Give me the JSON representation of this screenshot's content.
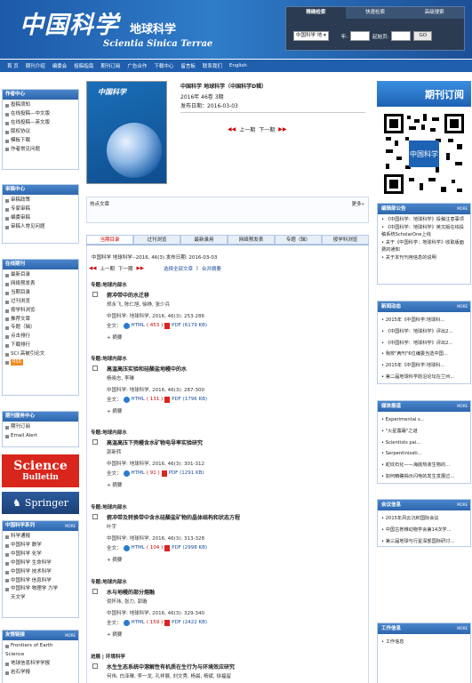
{
  "header": {
    "logo_cn": "中国科学",
    "logo_sub": "地球科学",
    "logo_en": "Scientia Sinica Terrae"
  },
  "search": {
    "tabs": [
      "精确检索",
      "快速检索",
      "高级搜索"
    ],
    "journal_select": "中国科学 地",
    "year_label": "年:",
    "page_label": "起始页:",
    "go": "GO"
  },
  "nav": [
    "首 页",
    "期刊介绍",
    "编委会",
    "投稿指南",
    "期刊订阅",
    "广告合作",
    "下载中心",
    "留言板",
    "联系我们",
    "English"
  ],
  "left": {
    "author_center": {
      "title": "作者中心",
      "items": [
        "投稿须知",
        "在线投稿—中文版",
        "在线投稿—英文版",
        "版权协议",
        "模板下载",
        "作者常见问题"
      ]
    },
    "review_center": {
      "title": "审稿中心",
      "items": [
        "审稿政策",
        "专家审稿",
        "编委审稿",
        "审稿人常见问题"
      ]
    },
    "online": {
      "title": "在线期刊",
      "items": [
        "最新目录",
        "网络预发表",
        "当期目录",
        "过刊浏览",
        "按学科浏览",
        "推荐文章",
        "专题（辑）",
        "点击排行",
        "下载排行",
        "SCI 高被引论文"
      ],
      "rss": "RSS"
    },
    "service": {
      "title": "期刊服务中心",
      "items": [
        "期刊订阅",
        "Email Alert"
      ]
    },
    "bulletin": {
      "line1": "Science",
      "line2": "Bulletin"
    },
    "springer": "Springer",
    "series": {
      "title": "中国科学系列",
      "more": "MORE",
      "items": [
        "科学通报",
        "中国科学 数学",
        "中国科学 化学",
        "中国科学 生命科学",
        "中国科学 技术科学",
        "中国科学 信息科学",
        "中国科学 物理学 力学",
        "天文学"
      ]
    },
    "links": {
      "title": "友情链接",
      "more": "MORE",
      "items": [
        "Frontiers of Earth",
        "Science",
        "地球信息科学学报",
        "岩石学报"
      ]
    }
  },
  "journal": {
    "title": "中国科学 地球科学（中国科学D辑）",
    "issue": "2016年 46卷 3期",
    "date": "发布日期：2016-03-03",
    "prev": "上一期",
    "next": "下一期",
    "cover_title": "中国科学"
  },
  "hot": {
    "title": "热点文章",
    "more": "更多»"
  },
  "tabs": [
    "当期目录",
    "过刊浏览",
    "最新录用",
    "网络预发表",
    "专题（辑）",
    "按学科浏览"
  ],
  "issue_line": "中国科学 地球科学--2016, 46(3)  发布日期: 2016-03-03",
  "select_all": "选择全部文章",
  "merge": "合并摘要",
  "articles": [
    {
      "topic": "专题:地球内部水",
      "title": "俯冲带中的水迁移",
      "authors": "郑永飞, 陈仁旭, 徐峥, 张少兵",
      "source": "中国科学: 地球科学, 2016, 46(3): 253-286",
      "html": "HTML",
      "html_n": "( 453 )",
      "pdf": "PDF (6179 KB)"
    },
    {
      "topic": "专题:地球内部水",
      "title": "高温高压实验和硅酸盐地幔中的水",
      "authors": "杨晓志, 李琳",
      "source": "中国科学: 地球科学, 2016, 46(3): 287-300",
      "html": "HTML",
      "html_n": "( 131 )",
      "pdf": "PDF (1796 KB)"
    },
    {
      "topic": "专题:地球内部水",
      "title": "高温高压下壳幔含水矿物电导率实验研究",
      "authors": "郭新转",
      "source": "中国科学: 地球科学, 2016, 46(3): 301-312",
      "html": "HTML",
      "html_n": "( 91 )",
      "pdf": "PDF (1291 KB)"
    },
    {
      "topic": "专题:地球内部水",
      "title": "俯冲带及转换带中含水硅酸盐矿物的晶体结构和状态方程",
      "authors": "叶宇",
      "source": "中国科学: 地球科学, 2016, 46(3): 313-328",
      "html": "HTML",
      "html_n": "( 104 )",
      "pdf": "PDF (2998 KB)"
    },
    {
      "topic": "专题:地球内部水",
      "title": "水与地幔的部分熔融",
      "authors": "倪怀玮, 张力, 郭璇",
      "source": "中国科学: 地球科学, 2016, 46(3): 329-340",
      "html": "HTML",
      "html_n": "( 159 )",
      "pdf": "PDF (2422 KB)"
    },
    {
      "topic": "进展 | 环境科学",
      "title": "水生生态系统中溶解性有机质在生行为与环境效应研究",
      "authors": "何伟, 白泽琳, 李一龙, 孔祥展, 刘文秀, 杨晨, 杨斌, 徐福留"
    }
  ],
  "full_label": "全文：",
  "abstract_label": "摘要",
  "right": {
    "subscribe": "期刊订阅",
    "editor": {
      "title": "编辑部公告",
      "more": "MORE",
      "items": [
        "《中国科学：地球科学》投稿注意事项",
        "《中国科学：地球科学》英文版在线投稿系统ScholarOne上线",
        "关于《中国科学：地球科学》收取版面费的通知",
        "关于本刊刊用信息的说明"
      ]
    },
    "news": {
      "title": "新闻动态",
      "more": "MORE",
      "items": [
        "2015年《中国科学:地球科...",
        "《中国科学：地球科学》评出2...",
        "《中国科学：地球科学》评出2...",
        "我校\"两刊\"6位编委当选中国...",
        "2015年《中国科学:地球科...",
        "第二届地球科学前沿论坛在兰州..."
      ]
    },
    "media": {
      "title": "媒体报道",
      "more": "MORE",
      "items": [
        "Experimental s...",
        "\"火星露霜\"之谜",
        "Scientists pai...",
        "Serpentinizati...",
        "蛇纹石化——海底热液生物的...",
        "如何精确揭示闪电的发生发展过..."
      ]
    },
    "meeting": {
      "title": "会议信息",
      "more": "MORE",
      "items": [
        "2015年风云沉积国际会议",
        "中国古脊椎动物学会第14次学...",
        "第三届地球与行星深部国际研讨..."
      ]
    },
    "work": {
      "title": "工作信息",
      "more": "MORE",
      "items": [
        "工作信息"
      ]
    }
  },
  "colors": {
    "brand": "#1f5fae",
    "accent": "#c00000"
  }
}
